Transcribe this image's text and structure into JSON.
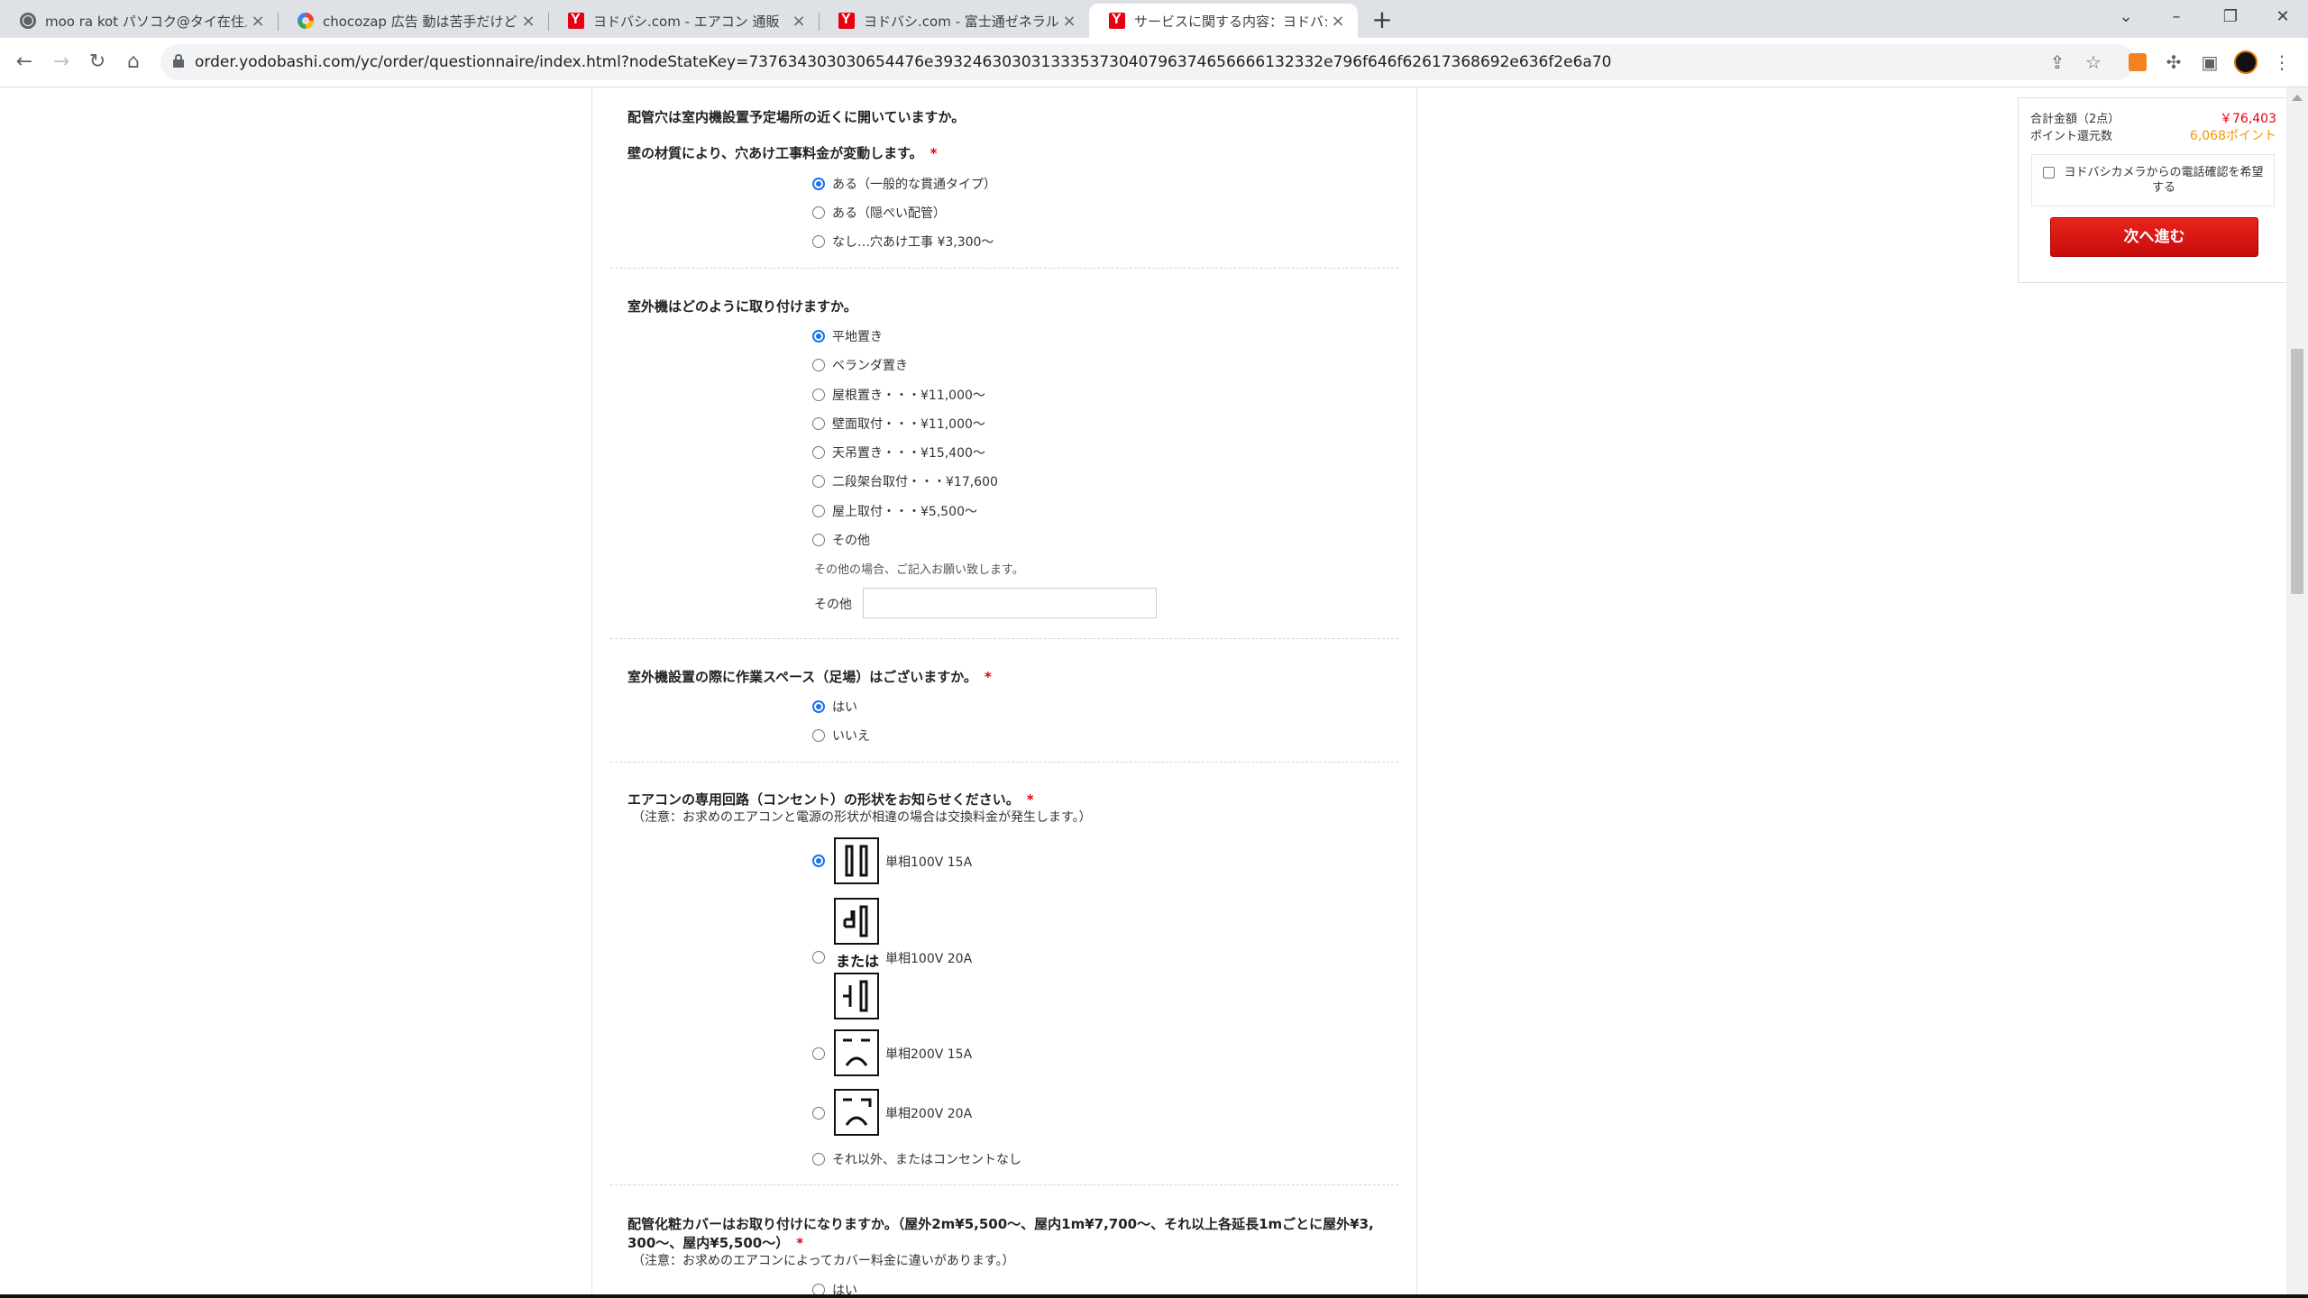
{
  "browser": {
    "tabs": [
      {
        "title": "moo ra kot パソコク@タイ在住／副",
        "icon": "globe-icon"
      },
      {
        "title": "chocozap 広告 動は苦手だけどス",
        "icon": "google-icon"
      },
      {
        "title": "ヨドバシ.com - エアコン 通販【全品",
        "icon": "yodobashi-icon"
      },
      {
        "title": "ヨドバシ.com - 富士通ゼネラル FUJ",
        "icon": "yodobashi-icon"
      },
      {
        "title": "サービスに関する内容：ヨドバシ.ドッ",
        "icon": "yodobashi-icon",
        "active": true
      }
    ],
    "url": "order.yodobashi.com/yc/order/questionnaire/index.html?nodeStateKey=737634303030654476e3932463030313335373040796374656666132332e796f646f62617368692e636f2e6a70"
  },
  "form": {
    "required_mark": "*",
    "q1": {
      "title": "配管穴は室内機設置予定場所の近くに開いていますか。",
      "subtitle": "壁の材質により、穴あけ工事料金が変動します。",
      "options": [
        "ある（一般的な貫通タイプ）",
        "ある（隠ぺい配管）",
        "なし…穴あけ工事 ¥3,300～"
      ],
      "selected": 0
    },
    "q2": {
      "title": "室外機はどのように取り付けますか。",
      "options": [
        "平地置き",
        "ベランダ置き",
        "屋根置き・・・¥11,000～",
        "壁面取付・・・¥11,000～",
        "天吊置き・・・¥15,400～",
        "二段架台取付・・・¥17,600",
        "屋上取付・・・¥5,500～",
        "その他"
      ],
      "selected": 0,
      "other_note": "その他の場合、ご記入お願い致します。",
      "other_label": "その他",
      "other_value": ""
    },
    "q3": {
      "title": "室外機設置の際に作業スペース（足場）はございますか。",
      "options": [
        "はい",
        "いいえ"
      ],
      "selected": 0
    },
    "q4": {
      "title": "エアコンの専用回路（コンセント）の形状をお知らせください。",
      "note": "（注意：お求めのエアコンと電源の形状が相違の場合は交換料金が発生します。）",
      "options": [
        "単相100V 15A",
        "単相100V 20A",
        "単相200V 15A",
        "単相200V 20A",
        "それ以外、またはコンセントなし"
      ],
      "or_text": "または",
      "selected": 0
    },
    "q5": {
      "title_line1": "配管化粧カバーはお取り付けになりますか。（屋外2m¥5,500～、屋内1m¥7,700～、それ以上各延長1mごとに屋外¥3,",
      "title_line2": "300～、屋内¥5,500～）",
      "note": "（注意：お求めのエアコンによってカバー料金に違いがあります。）",
      "first_option": "はい"
    }
  },
  "summary": {
    "total_label": "合計金額（2点）",
    "total_value": "￥76,403",
    "points_label": "ポイント還元数",
    "points_value": "6,068ポイント",
    "phone_confirm": "ヨドバシカメラからの電話確認を希望する",
    "next_button": "次へ進む"
  },
  "colors": {
    "accent_red": "#e60012",
    "points_orange": "#f39800",
    "radio_blue": "#1a73e8"
  }
}
